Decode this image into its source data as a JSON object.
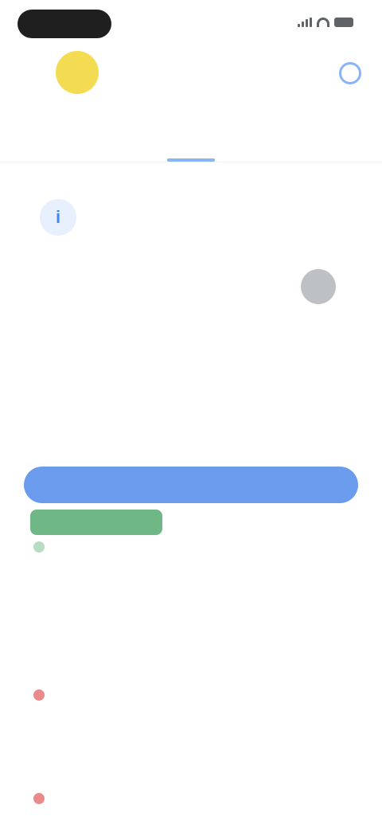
{
  "status_bar": {
    "time": ""
  },
  "header": {
    "stock_name": "",
    "stock_subtitle": ""
  },
  "tabs": [
    {
      "label": ""
    },
    {
      "label": ""
    },
    {
      "label": ""
    },
    {
      "label": ""
    },
    {
      "label": ""
    }
  ],
  "info": {
    "icon": "info-icon",
    "text": ""
  },
  "alert": {
    "text": ""
  },
  "section": {
    "title": "",
    "subtitle": ""
  },
  "range": {
    "left": "",
    "middle": "",
    "right": ""
  },
  "rows": [
    {
      "name": "",
      "sub": "",
      "value": "",
      "sub_right": ""
    },
    {
      "name": "",
      "sub": "",
      "value": "",
      "sub_right": ""
    },
    {
      "name": "",
      "sub": "",
      "value": "",
      "sub_right": ""
    }
  ],
  "link": {
    "label": ""
  },
  "colors": {
    "accent": "#4285f4",
    "positive": "#34a853",
    "negative": "#ea4335",
    "logo": "#f4dc52"
  }
}
